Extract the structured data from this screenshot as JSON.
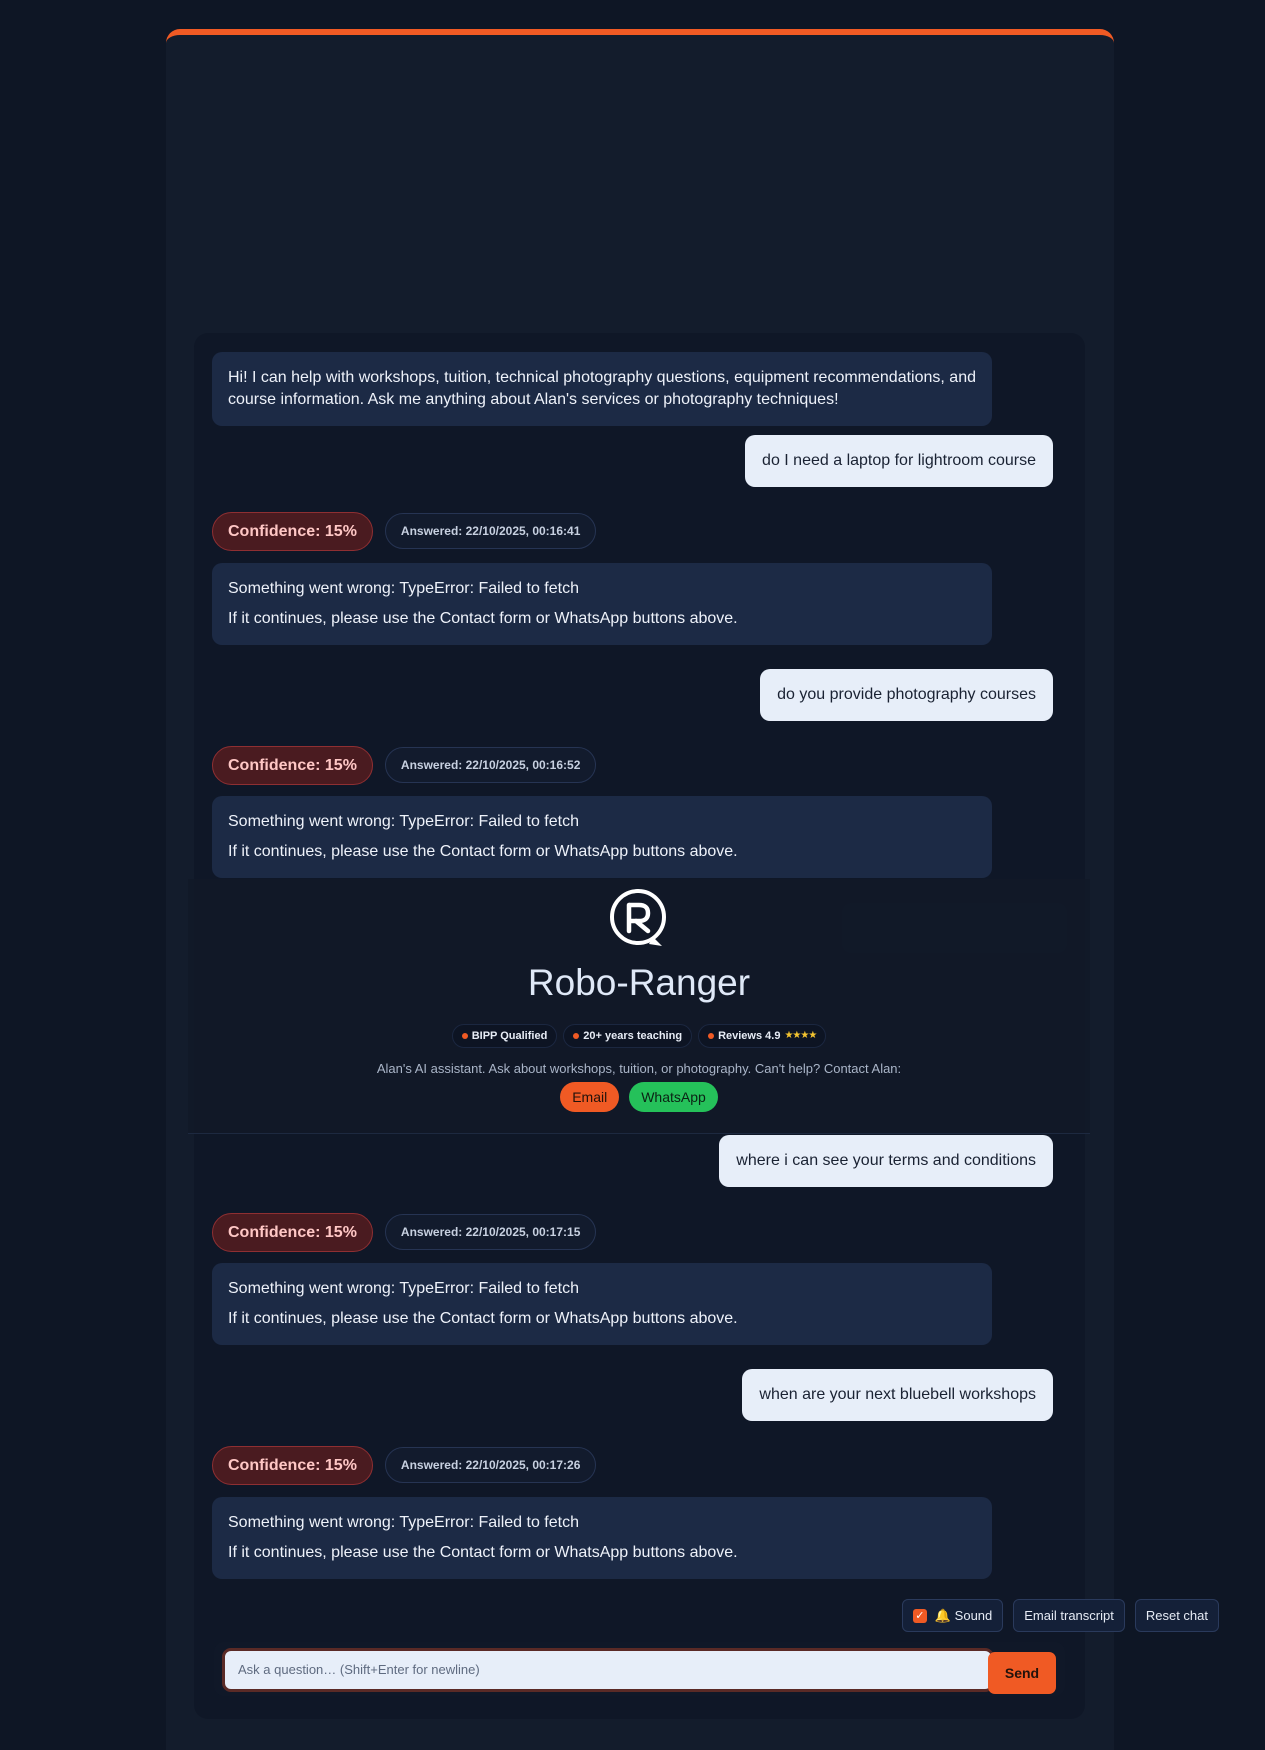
{
  "welcome_message": "Hi! I can help with workshops, tuition, technical photography questions, equipment recommendations, and course information. Ask me anything about Alan's services or photography techniques!",
  "conversation": [
    {
      "question": "do I need a laptop for lightroom course",
      "confidence": "Confidence: 15%",
      "answered": "Answered: 22/10/2025, 00:16:41",
      "error_line": "Something went wrong: TypeError: Failed to fetch",
      "help_line": "If it continues, please use the Contact form or WhatsApp buttons above."
    },
    {
      "question": "do you provide photography courses",
      "confidence": "Confidence: 15%",
      "answered": "Answered: 22/10/2025, 00:16:52",
      "error_line": "Something went wrong: TypeError: Failed to fetch",
      "help_line": "If it continues, please use the Contact form or WhatsApp buttons above."
    },
    {
      "question": "where i can see your terms and conditions",
      "confidence": "Confidence: 15%",
      "answered": "Answered: 22/10/2025, 00:17:15",
      "error_line": "Something went wrong: TypeError: Failed to fetch",
      "help_line": "If it continues, please use the Contact form or WhatsApp buttons above."
    },
    {
      "question": "when are your next bluebell workshops",
      "confidence": "Confidence: 15%",
      "answered": "Answered: 22/10/2025, 00:17:26",
      "error_line": "Something went wrong: TypeError: Failed to fetch",
      "help_line": "If it continues, please use the Contact form or WhatsApp buttons above."
    }
  ],
  "header": {
    "title": "Robo-Ranger",
    "badges": [
      "BIPP Qualified",
      "20+ years teaching",
      "Reviews 4.9"
    ],
    "stars": "★★★★",
    "tagline": "Alan's AI assistant. Ask about workshops, tuition, or photography. Can't help? Contact Alan:",
    "email_label": "Email",
    "whatsapp_label": "WhatsApp"
  },
  "toolbar": {
    "sound_label": "🔔 Sound",
    "sound_enabled": true,
    "email_transcript_label": "Email transcript",
    "reset_label": "Reset chat"
  },
  "composer": {
    "placeholder": "Ask a question… (Shift+Enter for newline)",
    "send_label": "Send"
  },
  "colors": {
    "accent": "#f05a24",
    "whatsapp": "#25c15a",
    "background": "#0e1625"
  }
}
